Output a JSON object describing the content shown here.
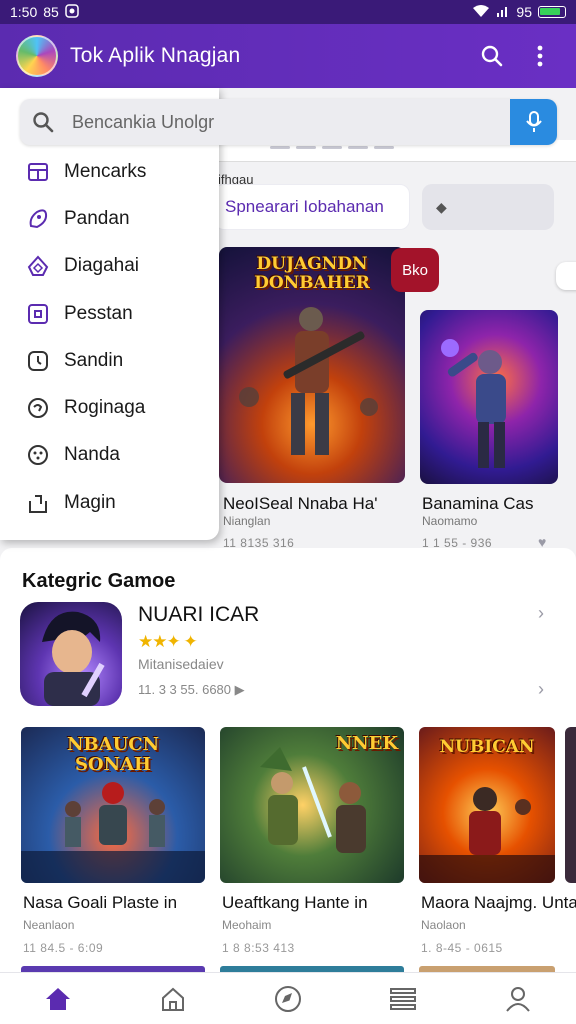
{
  "status_bar": {
    "time": "1:50",
    "extra": "85",
    "signal_text": "95"
  },
  "app_bar": {
    "title": "Tok Aplik Nnagjan"
  },
  "search": {
    "placeholder": "Bencankia Unolgr"
  },
  "drawer": {
    "items": [
      {
        "label": "Mencarks",
        "icon": "store-icon"
      },
      {
        "label": "Pandan",
        "icon": "tag-icon"
      },
      {
        "label": "Diagahai",
        "icon": "diamond-icon"
      },
      {
        "label": "Pesstan",
        "icon": "square-icon"
      },
      {
        "label": "Sandin",
        "icon": "clock-icon"
      },
      {
        "label": "Roginaga",
        "icon": "refresh-icon"
      },
      {
        "label": "Nanda",
        "icon": "dots-icon"
      },
      {
        "label": "Magin",
        "icon": "share-icon"
      }
    ]
  },
  "featured": {
    "section_label": "ifhgau",
    "chip_label": "Spnearari Iobahanan",
    "chip2_icon": "◆",
    "badge": "Bko",
    "cards": [
      {
        "art_title": "DUJAGNDN DONBAHER",
        "title": "NeoISeal Nnaba Ha'",
        "sub": "Nianglan",
        "meta": "11 8135 316"
      },
      {
        "art_title": "",
        "title": "Banamina Cas",
        "sub": "Naomamo",
        "meta": "1 1 55 - 936"
      }
    ]
  },
  "category": {
    "title": "Kategric Gamoe",
    "list_app": {
      "name": "NUARI ICAR",
      "stars": "★★✦ ✦",
      "developer": "Mitanisedaiev",
      "meta": "11. 3 3 55. 6680 ▶"
    },
    "grid": [
      {
        "art_title": "NBAUCN SONAH",
        "title": "Nasa Goali Plaste in",
        "sub": "Neanlaon",
        "meta": "11 84.5 - 6:09"
      },
      {
        "art_title": "NNEK",
        "title": "Ueaftkang Hante in",
        "sub": "Meohaim",
        "meta": "1 8 8:53 413"
      },
      {
        "art_title": "NUBICAN",
        "title": "Maora Naajmg. Unta",
        "sub": "Naolaon",
        "meta": "1. 8-45 - 0615"
      }
    ]
  },
  "bottom_nav": [
    {
      "name": "nav-home",
      "icon": "home-icon"
    },
    {
      "name": "nav-apps",
      "icon": "house-outline-icon"
    },
    {
      "name": "nav-explore",
      "icon": "compass-icon"
    },
    {
      "name": "nav-library",
      "icon": "list-icon"
    },
    {
      "name": "nav-profile",
      "icon": "person-icon"
    }
  ],
  "colors": {
    "primary": "#5b2bb0",
    "accent_blue": "#2a8be0",
    "badge_red": "#a3132a"
  }
}
